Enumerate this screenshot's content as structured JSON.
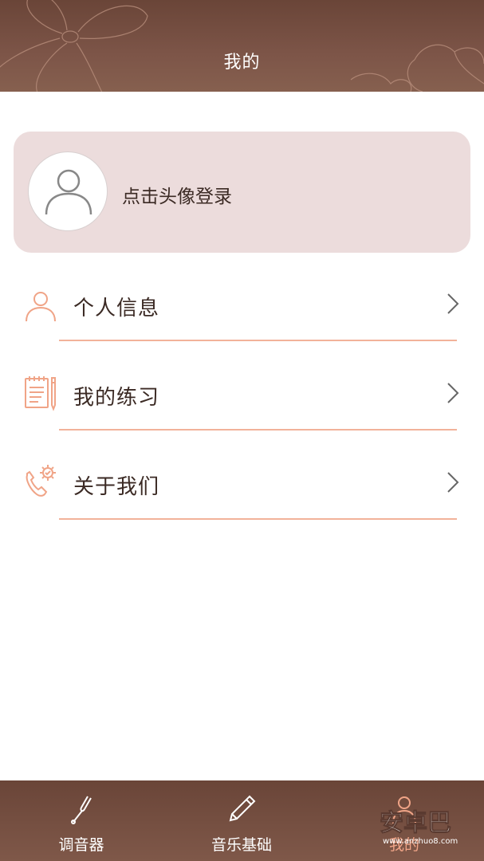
{
  "header": {
    "title": "我的"
  },
  "profile": {
    "login_prompt": "点击头像登录"
  },
  "menu": {
    "items": [
      {
        "label": "个人信息",
        "icon": "person-icon"
      },
      {
        "label": "我的练习",
        "icon": "notepad-icon"
      },
      {
        "label": "关于我们",
        "icon": "phone-gear-icon"
      }
    ]
  },
  "tabbar": {
    "tabs": [
      {
        "label": "调音器",
        "icon": "tuning-fork-icon",
        "active": false
      },
      {
        "label": "音乐基础",
        "icon": "pencil-icon",
        "active": false
      },
      {
        "label": "我的",
        "icon": "person-icon",
        "active": true
      }
    ]
  },
  "watermark": {
    "text": "安卓巴",
    "subtext": "www.anzhuo8.com"
  },
  "colors": {
    "header_brown": "#6a4538",
    "accent_orange": "#f0a487",
    "card_pink": "#ecdcdc",
    "text_dark": "#3b2a24"
  }
}
